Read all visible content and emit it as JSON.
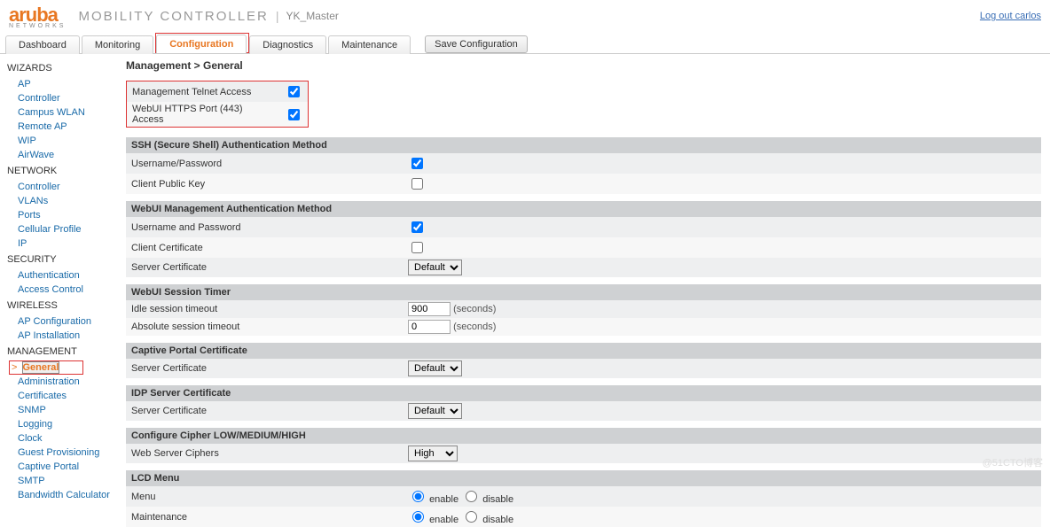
{
  "header": {
    "brand": "aruba",
    "brand_sub": "NETWORKS",
    "product": "MOBILITY CONTROLLER",
    "hostname": "YK_Master",
    "logout": "Log out carlos"
  },
  "tabs": {
    "dashboard": "Dashboard",
    "monitoring": "Monitoring",
    "configuration": "Configuration",
    "diagnostics": "Diagnostics",
    "maintenance": "Maintenance",
    "save": "Save Configuration"
  },
  "sidebar": {
    "wizards": "WIZARDS",
    "wizards_items": {
      "ap": "AP",
      "controller": "Controller",
      "campus": "Campus WLAN",
      "remote": "Remote AP",
      "wip": "WIP",
      "airwave": "AirWave"
    },
    "network": "NETWORK",
    "network_items": {
      "controller": "Controller",
      "vlans": "VLANs",
      "ports": "Ports",
      "cell": "Cellular Profile",
      "ip": "IP"
    },
    "security": "SECURITY",
    "security_items": {
      "auth": "Authentication",
      "access": "Access Control"
    },
    "wireless": "WIRELESS",
    "wireless_items": {
      "apconf": "AP Configuration",
      "apinst": "AP Installation"
    },
    "management": "MANAGEMENT",
    "management_items": {
      "general": "General",
      "admin": "Administration",
      "certs": "Certificates",
      "snmp": "SNMP",
      "logging": "Logging",
      "clock": "Clock",
      "guest": "Guest Provisioning",
      "captive": "Captive Portal",
      "smtp": "SMTP",
      "bw": "Bandwidth Calculator"
    }
  },
  "main": {
    "breadcrumb": "Management > General",
    "telnet": "Management Telnet Access",
    "https": "WebUI HTTPS Port (443) Access",
    "ssh_head": "SSH (Secure Shell) Authentication Method",
    "ssh_userpw": "Username/Password",
    "ssh_pubkey": "Client Public Key",
    "webui_auth_head": "WebUI Management Authentication Method",
    "webui_userpw": "Username and Password",
    "webui_cert": "Client Certificate",
    "webui_srvcert": "Server Certificate",
    "default_opt": "Default",
    "sess_head": "WebUI Session Timer",
    "sess_idle": "Idle session timeout",
    "sess_idle_val": "900",
    "sess_abs": "Absolute session timeout",
    "sess_abs_val": "0",
    "seconds": "(seconds)",
    "cp_head": "Captive Portal Certificate",
    "cp_srvcert": "Server Certificate",
    "idp_head": "IDP Server Certificate",
    "idp_srvcert": "Server Certificate",
    "cipher_head": "Configure Cipher LOW/MEDIUM/HIGH",
    "cipher_lbl": "Web Server Ciphers",
    "cipher_val": "High",
    "lcd_head": "LCD Menu",
    "lcd_menu": "Menu",
    "lcd_maint": "Maintenance",
    "enable": "enable",
    "disable": "disable"
  },
  "watermark": "@51CTO博客"
}
